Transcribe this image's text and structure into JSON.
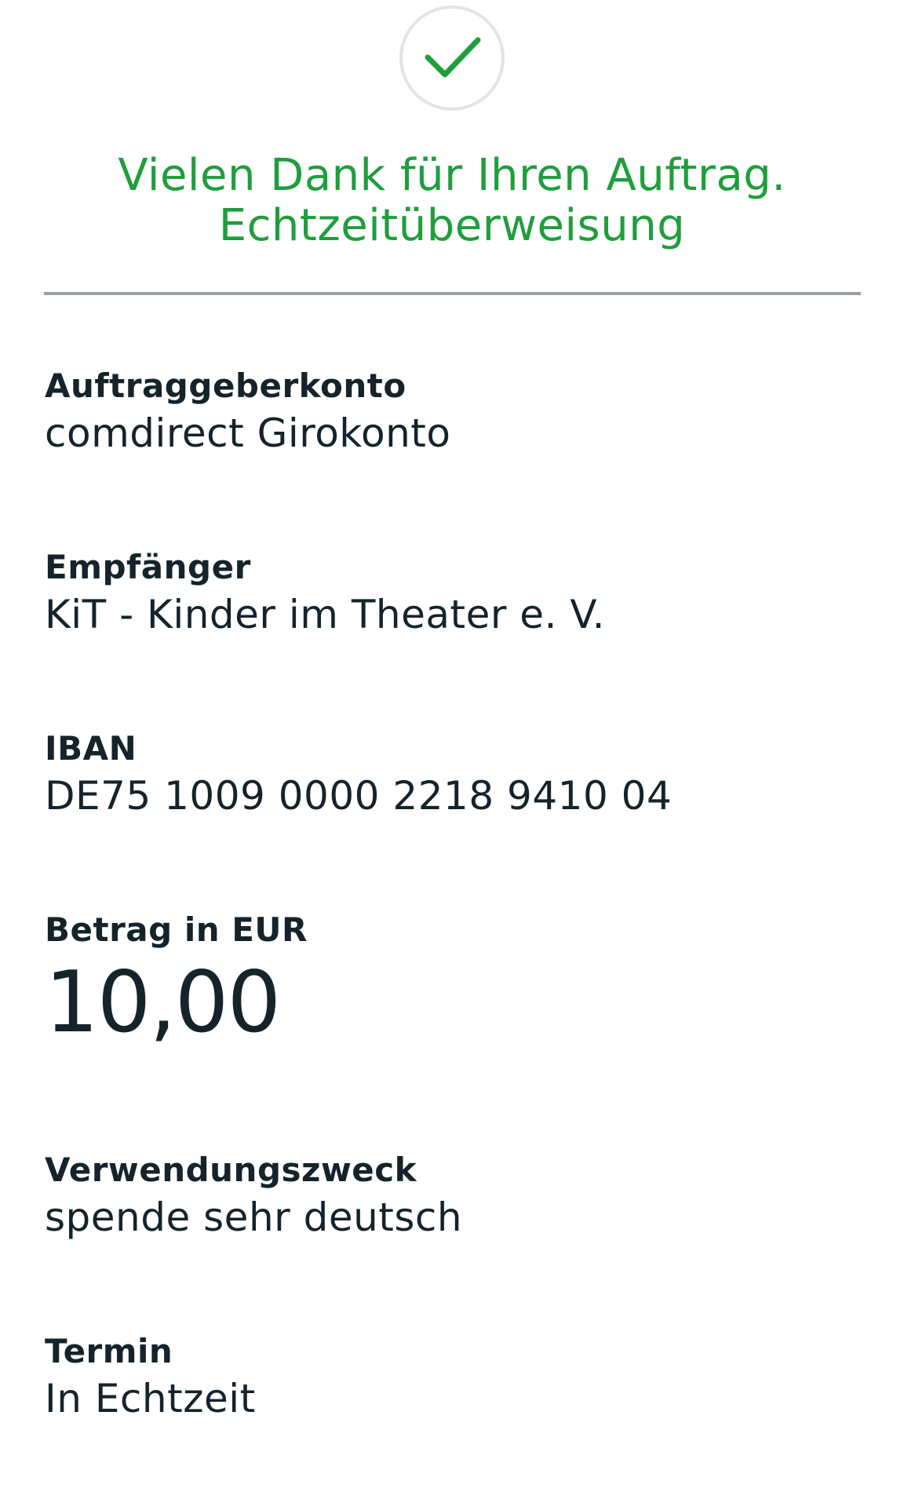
{
  "confirmation": {
    "title_line1": "Vielen Dank für Ihren Auftrag.",
    "title_line2": "Echtzeitüberweisung",
    "icon": "checkmark-icon",
    "accent_color": "#1f9e3c"
  },
  "details": {
    "account": {
      "label": "Auftraggeberkonto",
      "value": "comdirect Girokonto"
    },
    "recipient": {
      "label": "Empfänger",
      "value": "KiT - Kinder im Theater e. V."
    },
    "iban": {
      "label": "IBAN",
      "value": "DE75 1009 0000 2218 9410 04"
    },
    "amount": {
      "label": "Betrag in EUR",
      "value": "10,00"
    },
    "purpose": {
      "label": "Verwendungszweck",
      "value": "spende sehr deutsch"
    },
    "date": {
      "label": "Termin",
      "value": "In Echtzeit"
    }
  }
}
